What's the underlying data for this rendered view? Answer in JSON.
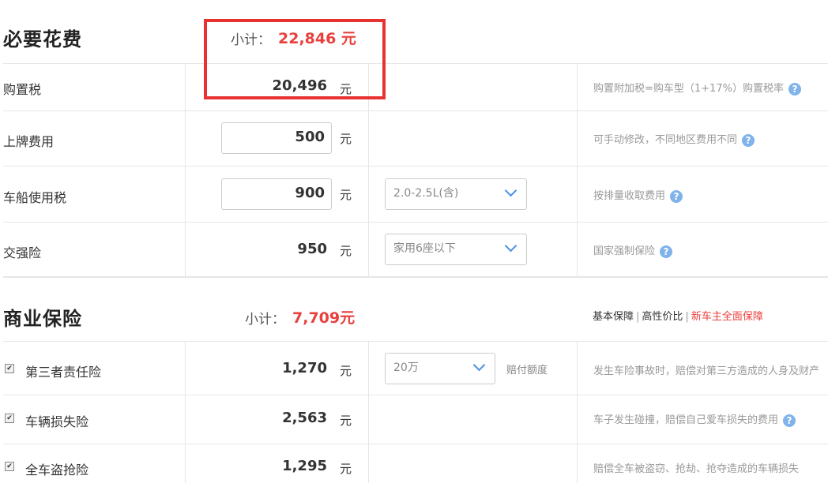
{
  "required": {
    "title": "必要花费",
    "subtotal_label": "小计：",
    "subtotal_value": "22,846 元",
    "rows": [
      {
        "label": "购置税",
        "value": "20,496",
        "unit": "元",
        "note": "购置附加税=购车型（1+17%）购置税率"
      },
      {
        "label": "上牌费用",
        "value": "500",
        "unit": "元",
        "note": "可手动修改，不同地区费用不同"
      },
      {
        "label": "车船使用税",
        "value": "900",
        "unit": "元",
        "select": "2.0-2.5L(含)",
        "note": "按排量收取费用"
      },
      {
        "label": "交强险",
        "value": "950",
        "unit": "元",
        "select": "家用6座以下",
        "note": "国家强制保险"
      }
    ]
  },
  "commercial": {
    "title": "商业保险",
    "subtotal_label": "小计：",
    "subtotal_value": "7,709元",
    "tabs": [
      "基本保障",
      "高性价比",
      "新车主全面保障"
    ],
    "rows": [
      {
        "label": "第三者责任险",
        "value": "1,270",
        "unit": "元",
        "select": "20万",
        "extra": "赔付额度",
        "note": "发生车险事故时，赔偿对第三方造成的人身及财产"
      },
      {
        "label": "车辆损失险",
        "value": "2,563",
        "unit": "元",
        "note": "车子发生碰撞，赔偿自己爱车损失的费用"
      },
      {
        "label": "全车盗抢险",
        "value": "1,295",
        "unit": "元",
        "note": "赔偿全车被盗窃、抢劫、抢夺造成的车辆损失"
      }
    ]
  },
  "icons": {
    "help": "?",
    "check": "✔"
  },
  "colors": {
    "accent_red": "#e8403d",
    "highlight_red": "#e83232",
    "help_blue": "#7fb3ea",
    "chevron_blue": "#4a90e2"
  }
}
